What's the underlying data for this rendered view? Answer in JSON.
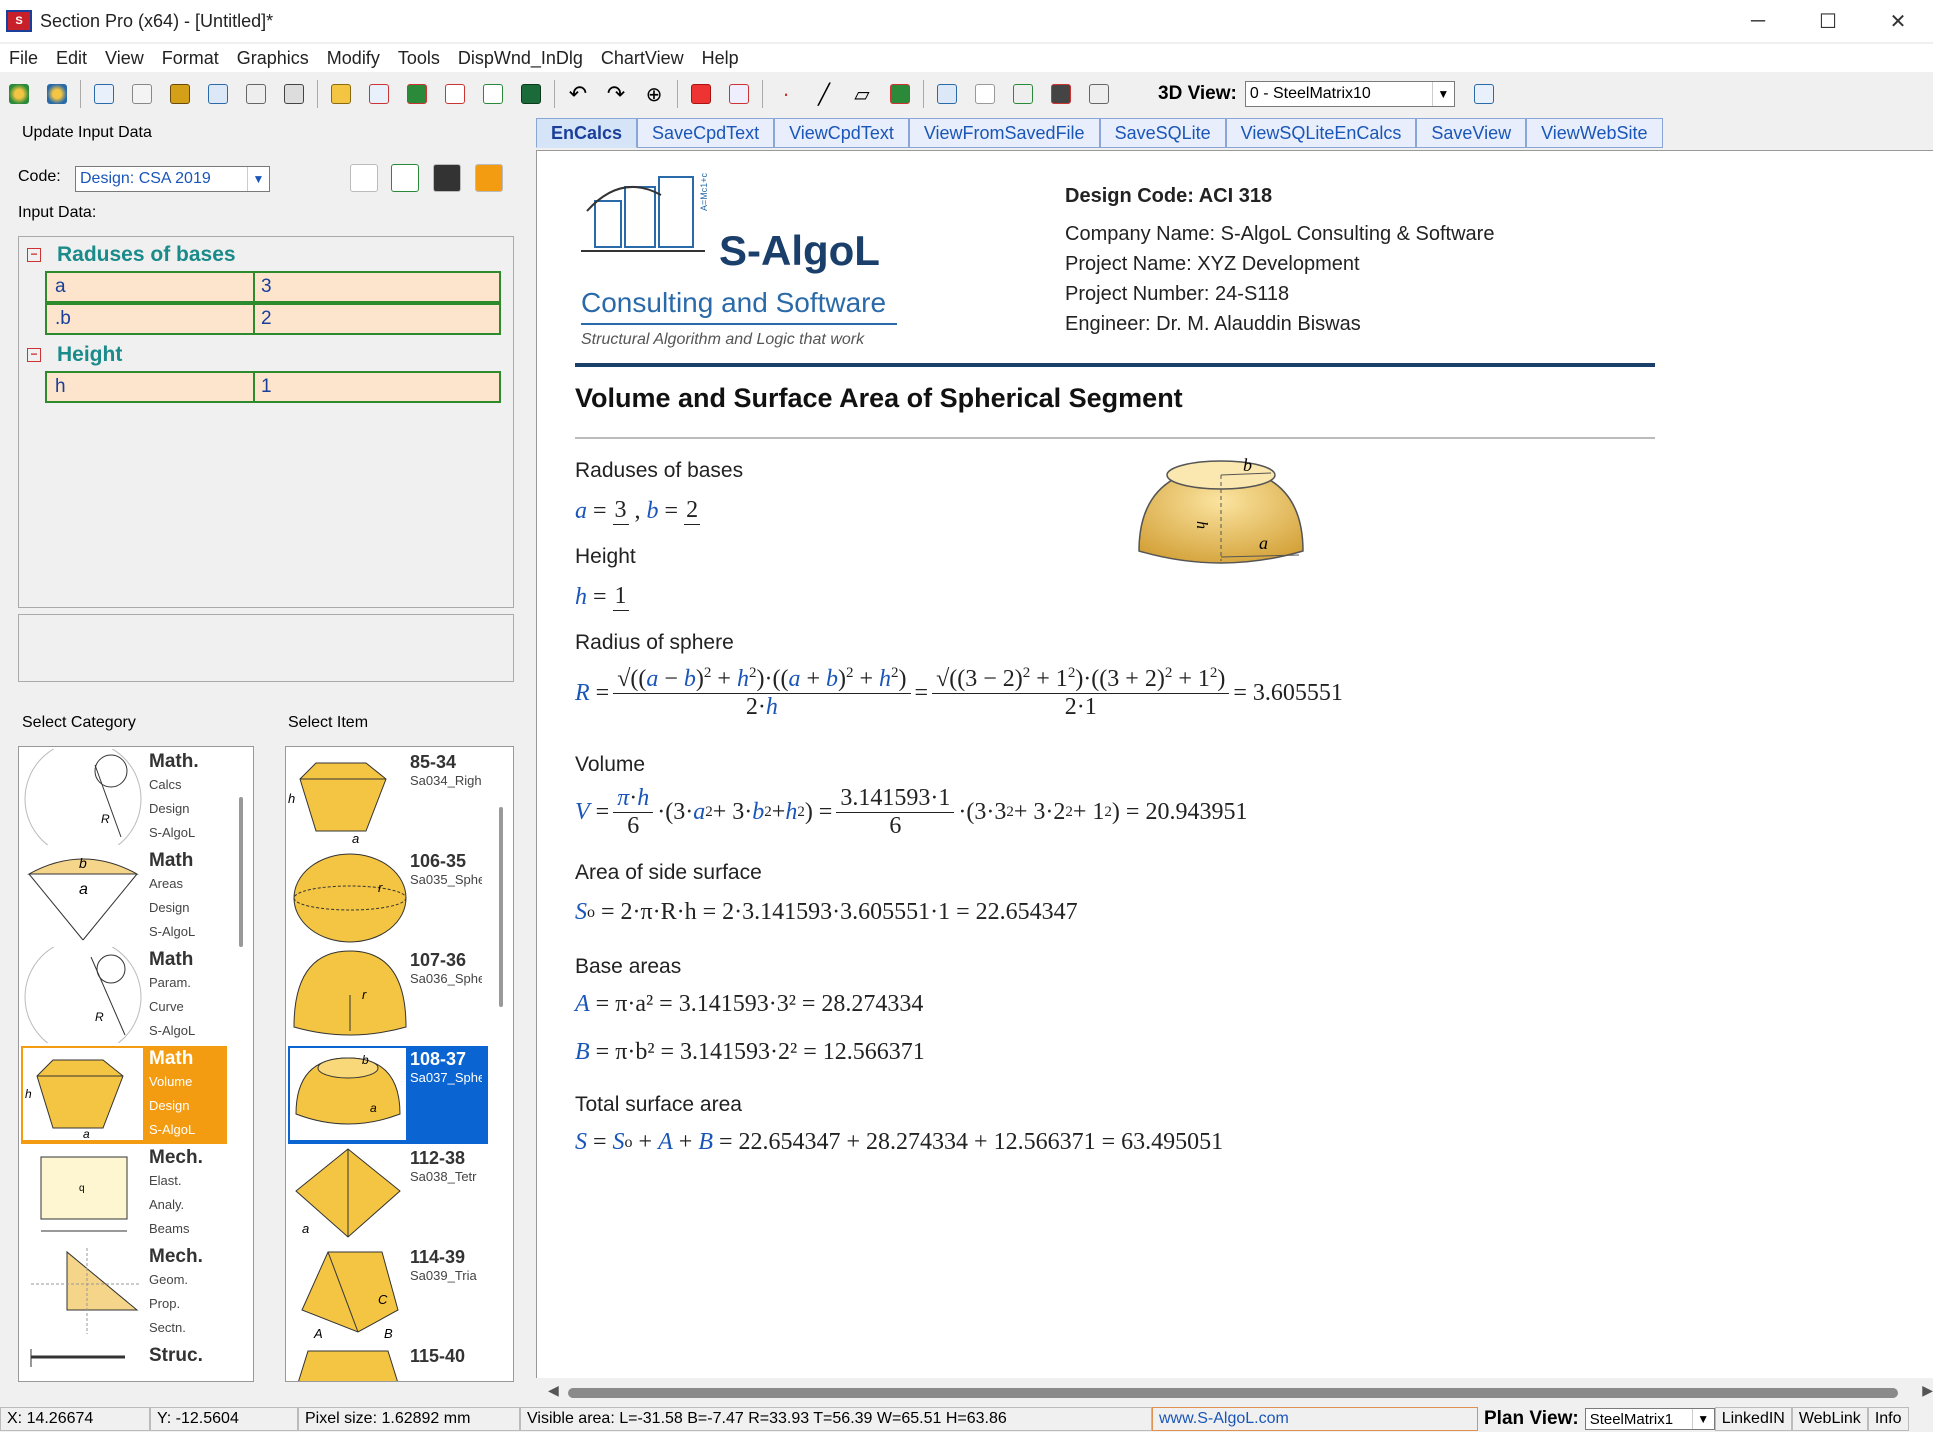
{
  "window": {
    "title": "Section Pro (x64) - [Untitled]*",
    "controls": [
      "─",
      "☐",
      "✕"
    ]
  },
  "menu": [
    "File",
    "Edit",
    "View",
    "Format",
    "Graphics",
    "Modify",
    "Tools",
    "DispWnd_InDlg",
    "ChartView",
    "Help"
  ],
  "toolbar": {
    "view3d_label": "3D View:",
    "view3d_value": "0 - SteelMatrix10"
  },
  "left": {
    "update_label": "Update Input Data",
    "code_label": "Code:",
    "code_value": "Design: CSA 2019",
    "input_data_label": "Input Data:",
    "sections": [
      {
        "title": "Raduses of bases",
        "rows": [
          {
            "name": "a",
            "value": "3"
          },
          {
            "name": ".b",
            "value": "2"
          }
        ]
      },
      {
        "title": "Height",
        "rows": [
          {
            "name": "h",
            "value": "1"
          }
        ]
      }
    ],
    "category_label": "Select Category",
    "item_label": "Select Item",
    "categories": [
      {
        "title": "Math.",
        "lines": [
          "Calcs",
          "Design",
          "S-AlgoL"
        ]
      },
      {
        "title": "Math",
        "lines": [
          "Areas",
          "Design",
          "S-AlgoL"
        ]
      },
      {
        "title": "Math",
        "lines": [
          "Param.",
          "Curve",
          "S-AlgoL"
        ]
      },
      {
        "title": "Math",
        "lines": [
          "Volume",
          "Design",
          "S-AlgoL"
        ]
      },
      {
        "title": "Mech.",
        "lines": [
          "Elast.",
          "Analy.",
          "Beams"
        ]
      },
      {
        "title": "Mech.",
        "lines": [
          "Geom.",
          "Prop.",
          "Sectn."
        ]
      },
      {
        "title": "Struc.",
        "lines": []
      }
    ],
    "items": [
      {
        "id": "85-34",
        "code": "Sa034_Righ"
      },
      {
        "id": "106-35",
        "code": "Sa035_Sphe"
      },
      {
        "id": "107-36",
        "code": "Sa036_Sphe"
      },
      {
        "id": "108-37",
        "code": "Sa037_Sphe"
      },
      {
        "id": "112-38",
        "code": "Sa038_Tetr"
      },
      {
        "id": "114-39",
        "code": "Sa039_Tria"
      },
      {
        "id": "115-40",
        "code": ""
      }
    ]
  },
  "tabs": [
    "EnCalcs",
    "SaveCpdText",
    "ViewCpdText",
    "ViewFromSavedFile",
    "SaveSQLite",
    "ViewSQLiteEnCalcs",
    "SaveView",
    "ViewWebSite"
  ],
  "doc": {
    "logo_brand": "S-AlgoL",
    "logo_sub": "Consulting and Software",
    "logo_tag": "Structural Algorithm and Logic that work",
    "design_code": "Design Code: ACI 318",
    "company": "Company Name: S-AlgoL Consulting & Software",
    "project_name": "Project Name: XYZ Development",
    "project_number": "Project Number: 24-S118",
    "engineer": "Engineer: Dr. M. Alauddin Biswas",
    "title": "Volume and Surface Area of Spherical Segment",
    "label_bases": "Raduses of bases",
    "label_height": "Height",
    "label_radius": "Radius of sphere",
    "label_volume": "Volume",
    "label_side": "Area of side surface",
    "label_base_areas": "Base areas",
    "label_total": "Total surface area",
    "val_a": "3",
    "val_b": "2",
    "val_h": "1",
    "R_result": "= 3.605551",
    "V_result": "= 20.943951",
    "So_rhs": "= 2·π·R·h = 2·3.141593·3.605551·1 = 22.654347",
    "A_rhs": "= π·a² = 3.141593·3² = 28.274334",
    "B_rhs": "= π·b² = 3.141593·2² = 12.566371",
    "S_rhs": "= 22.654347 + 28.274334 + 12.566371 = 63.495051"
  },
  "status": {
    "x": "X: 14.26674",
    "y": "Y: -12.5604",
    "pixel": "Pixel size: 1.62892 mm",
    "visible": "Visible area:  L=-31.58  B=-7.47  R=33.93  T=56.39   W=65.51  H=63.86",
    "website": "www.S-AlgoL.com",
    "plan_label": "Plan View:",
    "plan_value": "SteelMatrix1",
    "linkedin": "LinkedIN",
    "weblink": "WebLink",
    "info": "Info"
  }
}
